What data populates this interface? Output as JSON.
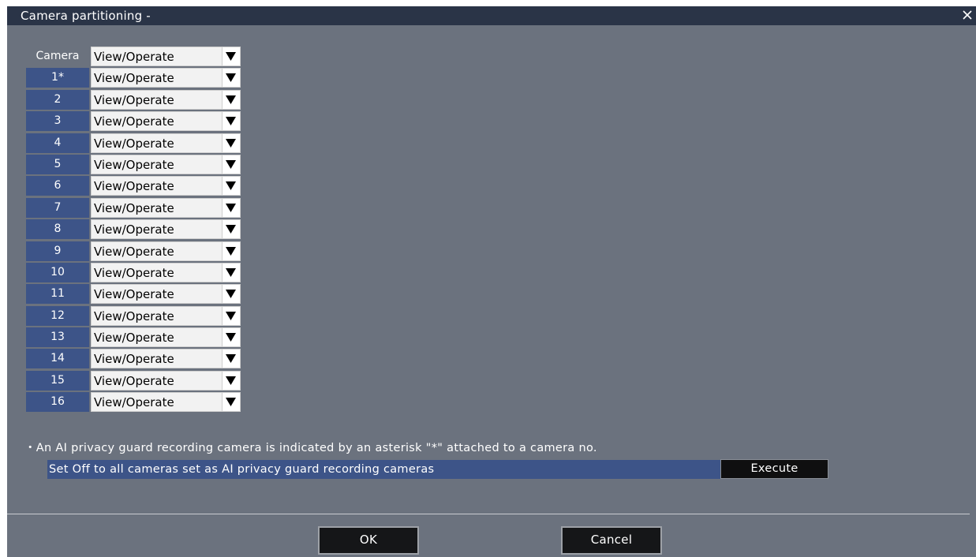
{
  "window": {
    "title": "Camera partitioning -"
  },
  "table": {
    "header_label": "Camera",
    "header_value": "View/Operate",
    "rows": [
      {
        "label": "1*",
        "value": "View/Operate"
      },
      {
        "label": "2",
        "value": "View/Operate"
      },
      {
        "label": "3",
        "value": "View/Operate"
      },
      {
        "label": "4",
        "value": "View/Operate"
      },
      {
        "label": "5",
        "value": "View/Operate"
      },
      {
        "label": "6",
        "value": "View/Operate"
      },
      {
        "label": "7",
        "value": "View/Operate"
      },
      {
        "label": "8",
        "value": "View/Operate"
      },
      {
        "label": "9",
        "value": "View/Operate"
      },
      {
        "label": "10",
        "value": "View/Operate"
      },
      {
        "label": "11",
        "value": "View/Operate"
      },
      {
        "label": "12",
        "value": "View/Operate"
      },
      {
        "label": "13",
        "value": "View/Operate"
      },
      {
        "label": "14",
        "value": "View/Operate"
      },
      {
        "label": "15",
        "value": "View/Operate"
      },
      {
        "label": "16",
        "value": "View/Operate"
      }
    ]
  },
  "note": "・An AI privacy guard recording camera is indicated by an asterisk \"*\" attached to a camera no.",
  "ai_off": {
    "text": "Set Off to all cameras set as AI privacy guard recording cameras",
    "button_label": "Execute"
  },
  "buttons": {
    "ok": "OK",
    "cancel": "Cancel"
  },
  "icons": {
    "close": "close-icon",
    "dropdown": "dropdown-arrow-icon"
  },
  "colors": {
    "titlebar": "#2a3447",
    "panel": "#6b727e",
    "label_bg": "#3d5488",
    "button_bg": "#151618"
  }
}
